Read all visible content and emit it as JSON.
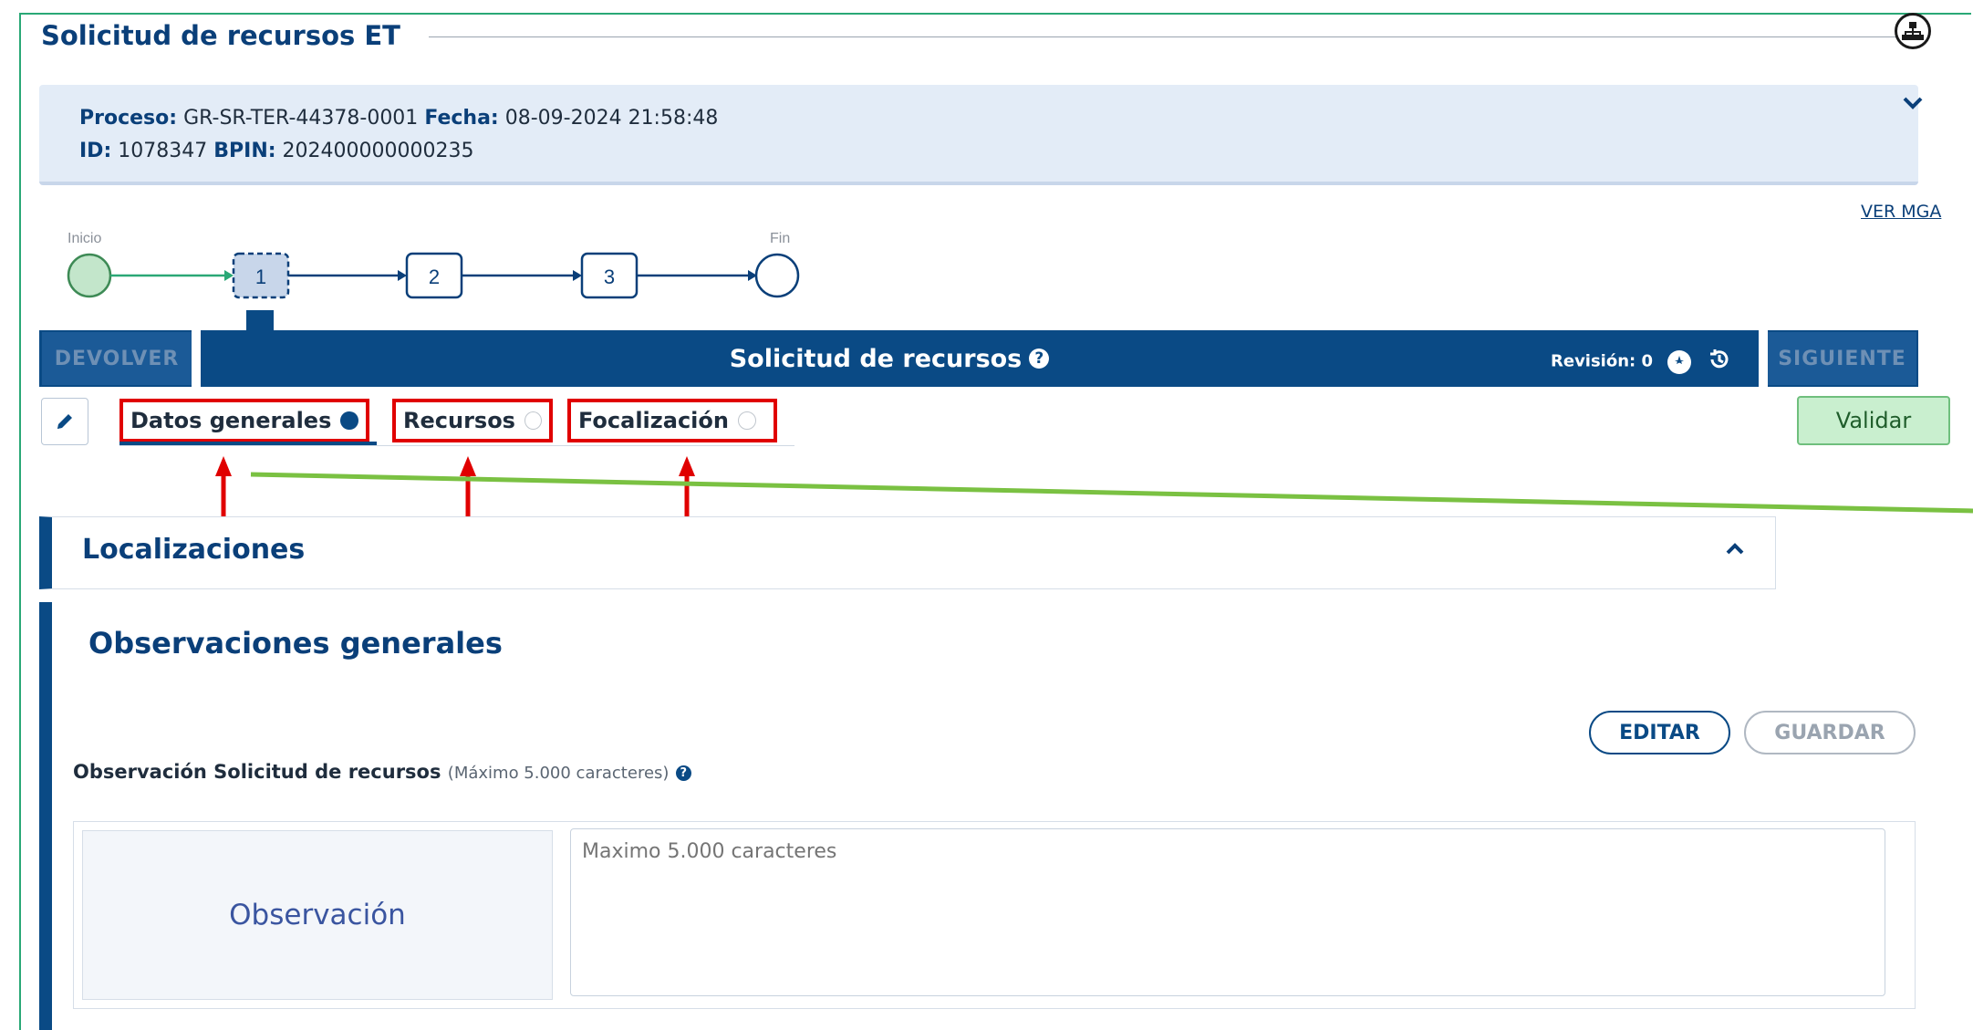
{
  "header": {
    "title": "Solicitud de recursos ET",
    "process_label": "Proceso:",
    "process_value": "GR-SR-TER-44378-0001",
    "date_label": "Fecha:",
    "date_value": "08-09-2024 21:58:48",
    "id_label": "ID:",
    "id_value": "1078347",
    "bpin_label": "BPIN:",
    "bpin_value": "202400000000235"
  },
  "ver_mga": "VER MGA",
  "flow": {
    "start_label": "Inicio",
    "end_label": "Fin",
    "steps": [
      "1",
      "2",
      "3"
    ],
    "active_step": "1"
  },
  "toolbar": {
    "back_label": "DEVOLVER",
    "title": "Solicitud de recursos",
    "revision_label": "Revisión: 0",
    "next_label": "SIGUIENTE"
  },
  "tabs": [
    {
      "label": "Datos generales",
      "status": "filled"
    },
    {
      "label": "Recursos",
      "status": "empty"
    },
    {
      "label": "Focalización",
      "status": "empty"
    }
  ],
  "validate_label": "Validar",
  "sections": {
    "localizaciones": "Localizaciones",
    "observaciones": "Observaciones generales"
  },
  "observaciones": {
    "edit_label": "EDITAR",
    "save_label": "GUARDAR",
    "field_label": "Observación Solicitud de recursos",
    "field_hint": "(Máximo 5.000 caracteres)",
    "column_label": "Observación",
    "placeholder": "Maximo 5.000 caracteres"
  },
  "colors": {
    "primary": "#0a4a85",
    "highlight": "#e00000",
    "frame": "#2aa876",
    "annotation_line": "#7ac142"
  }
}
